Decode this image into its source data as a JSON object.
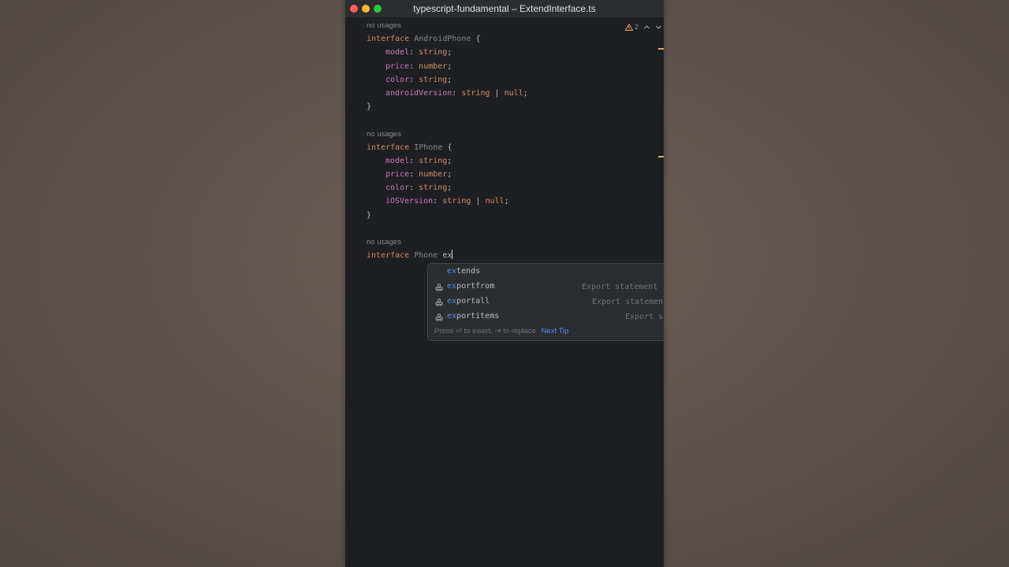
{
  "window": {
    "title": "typescript-fundamental – ExtendInterface.ts"
  },
  "status": {
    "warning_count": "2"
  },
  "code": {
    "hint_no_usages": "no usages",
    "kw_interface": "interface",
    "name_android": "AndroidPhone",
    "name_iphone": "IPhone",
    "name_phone": "Phone",
    "brace_open": "{",
    "brace_close": "}",
    "prop_model": "model",
    "prop_price": "price",
    "prop_color": "color",
    "prop_android_version": "androidVersion",
    "prop_ios_version": "iOSVersion",
    "colon": ":",
    "semi": ";",
    "type_string": "string",
    "type_number": "number",
    "type_null": "null",
    "pipe": "|",
    "typed_text": "ex"
  },
  "completion": {
    "match_prefix": "ex",
    "items": [
      {
        "rest": "tends",
        "detail": ""
      },
      {
        "rest": "portfrom",
        "detail": "Export statement"
      },
      {
        "rest": "portall",
        "detail": "Export statement"
      },
      {
        "rest": "portitems",
        "detail": "Export statement"
      }
    ],
    "footer_text": "Press ⏎ to insert, ⇥ to replace",
    "footer_link": "Next Tip"
  },
  "colors": {
    "keyword": "#cf8e6d",
    "property": "#c77dbb",
    "match": "#548af7",
    "background": "#1e1f22"
  },
  "icons": [
    "warning-icon",
    "chevron-up-icon",
    "chevron-down-icon",
    "template-stamp-icon"
  ]
}
